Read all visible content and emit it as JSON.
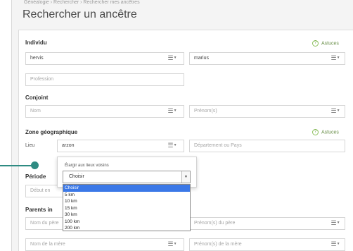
{
  "breadcrumb": "Généalogie › Rechercher › Rechercher mes ancêtres",
  "page_title": "Rechercher un ancêtre",
  "tips_label": "Astuces",
  "individu": {
    "label": "Individu",
    "nom_value": "hervis",
    "prenom_value": "marius",
    "profession_placeholder": "Profession"
  },
  "conjoint": {
    "label": "Conjoint",
    "nom_placeholder": "Nom",
    "prenom_placeholder": "Prénom(s)"
  },
  "zone": {
    "label": "Zone géographique",
    "lieu_label": "Lieu",
    "lieu_value": "arzon",
    "departement_placeholder": "Département ou Pays"
  },
  "periode": {
    "label": "Période",
    "debut_placeholder": "Début en"
  },
  "parents": {
    "label": "Parents in",
    "nom_pere_placeholder": "Nom du père",
    "prenom_pere_placeholder": "Prénom(s) du père",
    "nom_mere_placeholder": "Nom de la mère",
    "prenom_mere_placeholder": "Prénom(s) de la mère"
  },
  "popover": {
    "label": "Élargir aux lieux voisins",
    "selected": "Choisir",
    "options": [
      "Choisir",
      "5 km",
      "10 km",
      "15 km",
      "30 km",
      "100 km",
      "200 km"
    ]
  },
  "menu_icon": "list-menu-icon",
  "accent_color": "#2e8b82"
}
